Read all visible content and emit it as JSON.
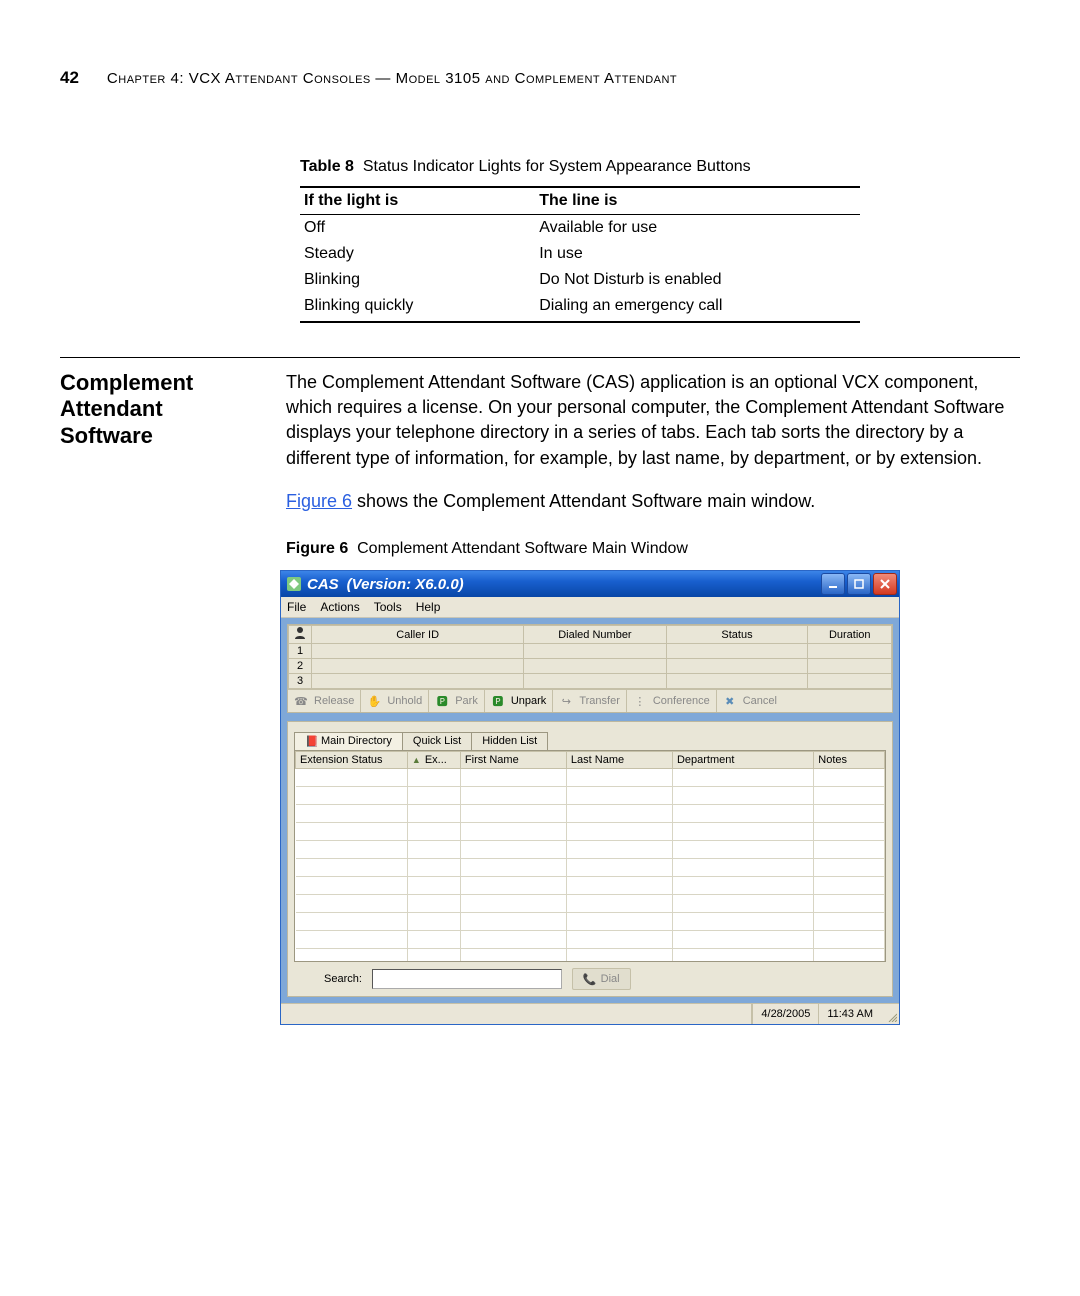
{
  "header": {
    "page_number": "42",
    "chapter_label": "Chapter 4: VCX Attendant Consoles — Model 3105 and Complement Attendant"
  },
  "table8": {
    "caption_label": "Table 8",
    "caption_text": "Status Indicator Lights for System Appearance Buttons",
    "head_light": "If the light is",
    "head_line": "The line is",
    "rows": [
      {
        "light": "Off",
        "line": "Available for use"
      },
      {
        "light": "Steady",
        "line": "In use"
      },
      {
        "light": "Blinking",
        "line": "Do Not Disturb is enabled"
      },
      {
        "light": "Blinking quickly",
        "line": "Dialing an emergency call"
      }
    ]
  },
  "section": {
    "heading": "Complement Attendant Software",
    "para1": "The Complement Attendant Software (CAS) application is an optional VCX component, which requires a license. On your personal computer, the Complement Attendant Software displays your telephone directory in a series of tabs. Each tab sorts the directory by a different type of information, for example, by last name, by department, or by extension.",
    "para2_link": "Figure 6",
    "para2_after": " shows the Complement Attendant Software main window."
  },
  "figure6": {
    "caption_label": "Figure 6",
    "caption_text": "Complement Attendant Software Main Window"
  },
  "cas": {
    "title_app": "CAS",
    "title_version": "(Version: X6.0.0)",
    "menu": {
      "file": "File",
      "actions": "Actions",
      "tools": "Tools",
      "help": "Help"
    },
    "call_cols": {
      "caller_id": "Caller ID",
      "dialed_number": "Dialed Number",
      "status": "Status",
      "duration": "Duration"
    },
    "row_nums": [
      "1",
      "2",
      "3"
    ],
    "actions_bar": {
      "release": "Release",
      "unhold": "Unhold",
      "park": "Park",
      "unpark": "Unpark",
      "transfer": "Transfer",
      "conference": "Conference",
      "cancel": "Cancel"
    },
    "tabs": {
      "main": "Main Directory",
      "quick": "Quick List",
      "hidden": "Hidden List"
    },
    "dir_cols": {
      "ext_status": "Extension Status",
      "ex": "Ex...",
      "first_name": "First Name",
      "last_name": "Last Name",
      "department": "Department",
      "notes": "Notes"
    },
    "search_label": "Search:",
    "dial_label": "Dial",
    "status_date": "4/28/2005",
    "status_time": "11:43 AM"
  }
}
